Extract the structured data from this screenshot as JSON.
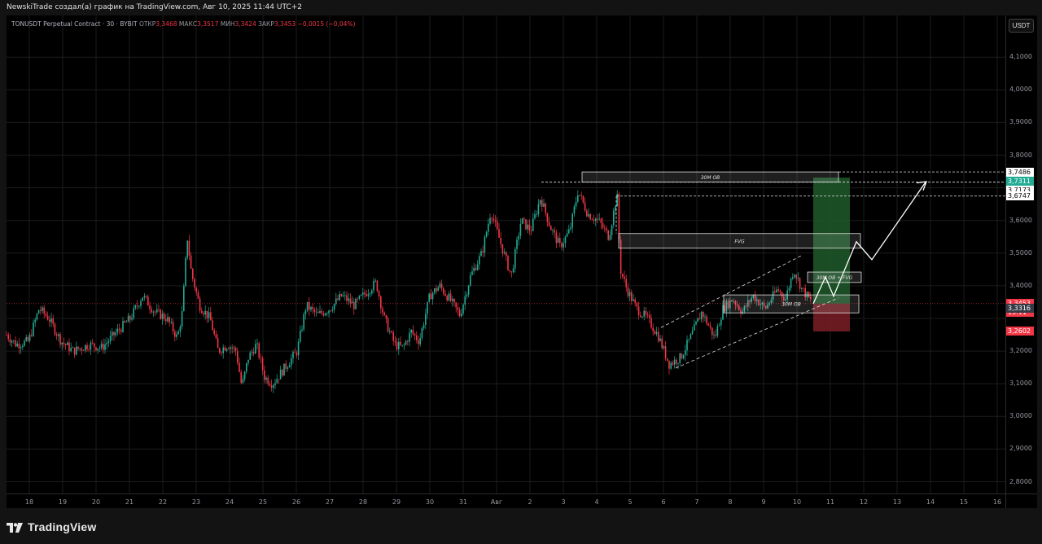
{
  "header": {
    "title": "NewskiTrade создал(а) график на TradingView.com, Авг 10, 2025 11:44 UTC+2"
  },
  "legend": {
    "symbol": "TONUSDT Perpetual Contract · 30 · BYBIT",
    "open_label": "ОТКР",
    "open": "3,3468",
    "high_label": "МАКС",
    "high": "3,3517",
    "low_label": "МИН",
    "low": "3,3424",
    "close_label": "ЗАКР",
    "close": "3,3453",
    "change": "−0,0015 (−0,04%)"
  },
  "currency_button": "USDT",
  "price_axis": {
    "labels": [
      "4,1000",
      "4,0000",
      "3,9000",
      "3,8000",
      "3,6000",
      "3,5000",
      "3,4000",
      "3,2000",
      "3,1000",
      "3,0000",
      "2,9000",
      "2,8000"
    ],
    "label_values": [
      4.1,
      4.0,
      3.9,
      3.8,
      3.6,
      3.5,
      3.4,
      3.2,
      3.1,
      3.0,
      2.9,
      2.8
    ]
  },
  "price_tags": {
    "t1": {
      "text": "3,7486",
      "value": 3.7486,
      "bg": "#ffffff",
      "fg": "#000000"
    },
    "t2": {
      "text": "3,7311",
      "value": 3.7311,
      "bg": "#22ab94",
      "fg": "#ffffff"
    },
    "t3": {
      "text": "3,7173",
      "value": 3.7173,
      "bg": "#ffffff",
      "fg": "#000000"
    },
    "t4": {
      "text": "3,6747",
      "value": 3.6747,
      "bg": "#ffffff",
      "fg": "#000000"
    },
    "t5": {
      "text": "3,3453",
      "value": 3.3453,
      "bg": "#f23645",
      "fg": "#ffffff"
    },
    "countdown": "15:11",
    "t6": {
      "text": "3,3316",
      "value": 3.3316,
      "bg": "#363a45",
      "fg": "#ffffff"
    },
    "t7": {
      "text": "3,2602",
      "value": 3.2602,
      "bg": "#f23645",
      "fg": "#ffffff"
    }
  },
  "time_axis": {
    "labels": [
      "18",
      "19",
      "20",
      "21",
      "22",
      "23",
      "24",
      "25",
      "26",
      "27",
      "28",
      "29",
      "30",
      "31",
      "Авг",
      "2",
      "3",
      "4",
      "5",
      "6",
      "7",
      "8",
      "9",
      "10",
      "11",
      "12",
      "13",
      "14",
      "15",
      "16"
    ]
  },
  "zones": {
    "ob_top": "30M OB",
    "fvg": "FVG",
    "ob_fvg": "30M OB + FVG",
    "ob_bottom": "30M OB"
  },
  "colors": {
    "up": "#22ab94",
    "down": "#f23645",
    "target": "#1e5a2a",
    "stop": "#7a1f26"
  },
  "footer": {
    "brand": "TradingView"
  }
}
